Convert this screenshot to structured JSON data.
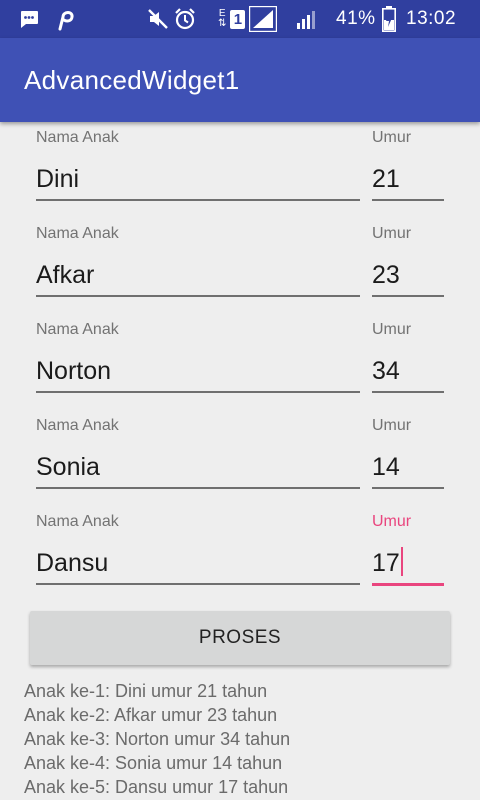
{
  "status_bar": {
    "network_type": "E",
    "sim_number": "1",
    "battery_percent": "41%",
    "time": "13:02",
    "icons": [
      "chat-notification-icon",
      "pinterest-icon",
      "mute-icon",
      "alarm-icon",
      "sim1-signal-icon",
      "sim2-signal-icon",
      "battery-charging-icon"
    ],
    "color": "#303f9f"
  },
  "app_bar": {
    "title": "AdvancedWidget1",
    "color": "#3f51b5"
  },
  "form": {
    "rows": [
      {
        "name_label": "Nama Anak",
        "name_value": "Dini",
        "age_label": "Umur",
        "age_value": "21"
      },
      {
        "name_label": "Nama Anak",
        "name_value": "Afkar",
        "age_label": "Umur",
        "age_value": "23"
      },
      {
        "name_label": "Nama Anak",
        "name_value": "Norton",
        "age_label": "Umur",
        "age_value": "34"
      },
      {
        "name_label": "Nama Anak",
        "name_value": "Sonia",
        "age_label": "Umur",
        "age_value": "14"
      },
      {
        "name_label": "Nama Anak",
        "name_value": "Dansu",
        "age_label": "Umur",
        "age_value": "17"
      }
    ],
    "focused_field": "age-field-5",
    "accent_color": "#e9457e"
  },
  "process_button": {
    "label": "PROSES"
  },
  "results": [
    "Anak ke-1: Dini umur 21 tahun",
    "Anak ke-2: Afkar umur 23 tahun",
    "Anak ke-3: Norton umur 34 tahun",
    "Anak ke-4: Sonia umur 14 tahun",
    "Anak ke-5: Dansu umur 17 tahun"
  ]
}
